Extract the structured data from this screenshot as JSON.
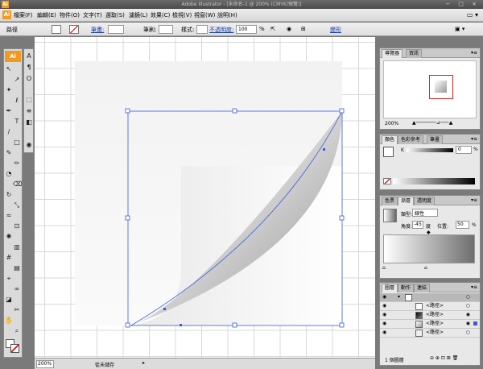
{
  "window": {
    "title": "Adobe Illustrator - [未命名-1 @ 200% (CMYK/預覽)]",
    "app_badge": "Ai",
    "controls": "− □ ×"
  },
  "menu": {
    "items": [
      "檔案(F)",
      "編輯(E)",
      "物件(O)",
      "文字(T)",
      "選取(S)",
      "濾鏡(L)",
      "效果(C)",
      "檢視(V)",
      "視窗(W)",
      "說明(H)"
    ]
  },
  "control_bar": {
    "selection_label": "路徑",
    "stroke_label": "筆畫:",
    "brush_label": "筆刷:",
    "style_label": "樣式:",
    "opacity_label": "不透明度:",
    "opacity_value": "100",
    "percent": "%",
    "transform_label": "變形"
  },
  "toolbox": {
    "badge": "Ai",
    "tools": [
      "selection",
      "direct-selection",
      "magic-wand",
      "lasso",
      "pen",
      "type",
      "line",
      "rectangle",
      "paintbrush",
      "pencil",
      "blob-brush",
      "eraser",
      "rotate",
      "scale",
      "warp",
      "free-transform",
      "symbol-sprayer",
      "graph",
      "mesh",
      "gradient",
      "eyedropper",
      "blend",
      "live-paint",
      "scissors",
      "hand",
      "zoom"
    ]
  },
  "status": {
    "zoom": "200%",
    "text": "從未儲存"
  },
  "navigator": {
    "tabs": [
      "導覽器",
      "資訊"
    ],
    "zoom": "200%"
  },
  "color": {
    "tabs": [
      "顏色",
      "色彩參考",
      "筆畫"
    ],
    "channel": "K",
    "value": "0",
    "percent": "%"
  },
  "gradient": {
    "tabs": [
      "色票",
      "漸層",
      "透明度"
    ],
    "type_label": "類型:",
    "type_value": "線性",
    "angle_label": "角度:",
    "angle_value": "-45",
    "angle_unit": "度",
    "position_label": "位置:",
    "position_value": "50",
    "percent": "%"
  },
  "layers": {
    "tabs": [
      "圖層",
      "動作",
      "連結"
    ],
    "rows": [
      {
        "name": "<路徑>"
      },
      {
        "name": "<路徑>"
      },
      {
        "name": "<路徑>"
      },
      {
        "name": "<路徑>"
      }
    ],
    "footer": "1 個圖層"
  },
  "colors": {
    "accent": "#f29a1e",
    "selection": "#3b5bdb",
    "link": "#1a3ea8"
  }
}
